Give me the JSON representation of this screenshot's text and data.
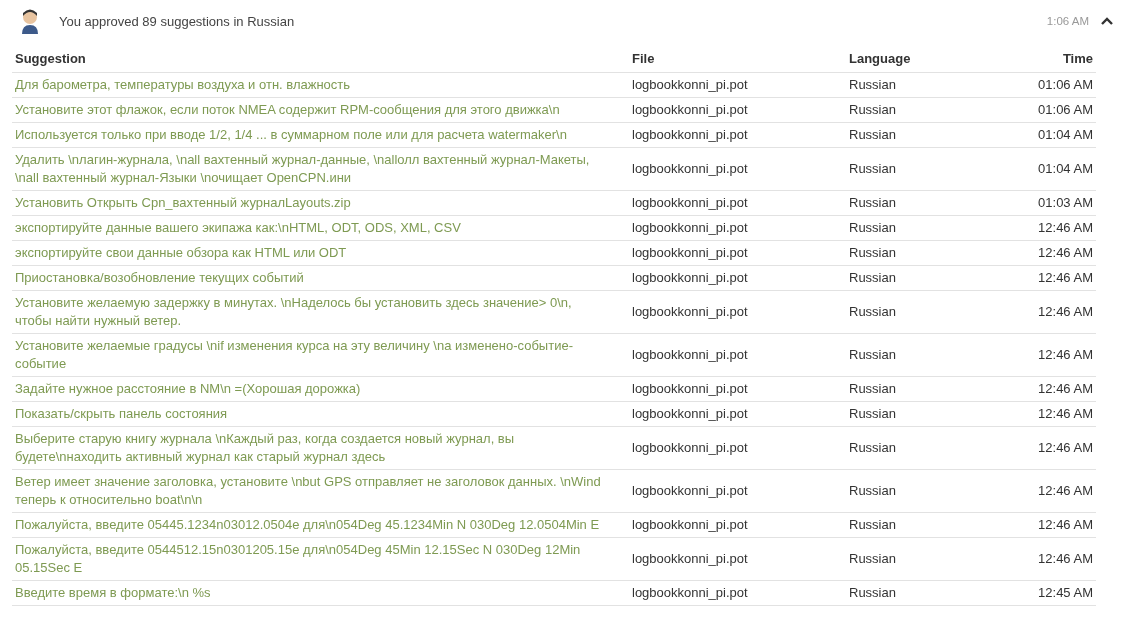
{
  "header": {
    "message": "You approved 89 suggestions in Russian",
    "time": "1:06 AM",
    "expanded": true
  },
  "table": {
    "columns": [
      "Suggestion",
      "File",
      "Language",
      "Time"
    ],
    "rows": [
      {
        "suggestion": "Для барометра, температуры воздуха и отн. влажность",
        "file": "logbookkonni_pi.pot",
        "language": "Russian",
        "time": "01:06 AM"
      },
      {
        "suggestion": "Установите этот флажок, если поток NMEA содержит RPM-сообщения для этого движка\\n",
        "file": "logbookkonni_pi.pot",
        "language": "Russian",
        "time": "01:06 AM"
      },
      {
        "suggestion": "Используется только при вводе 1/2, 1/4 ... в суммарном поле или для расчета watermaker\\n",
        "file": "logbookkonni_pi.pot",
        "language": "Russian",
        "time": "01:04 AM"
      },
      {
        "suggestion": "Удалить \\nлагин-журнала, \\nall вахтенный журнал-данные, \\nallолл вахтенный журнал-Макеты, \\nall вахтенный журнал-Языки \\nочищает OpenCPN.ини",
        "file": "logbookkonni_pi.pot",
        "language": "Russian",
        "time": "01:04 AM"
      },
      {
        "suggestion": "Установить Открыть Cpn_вахтенный журналLayouts.zip",
        "file": "logbookkonni_pi.pot",
        "language": "Russian",
        "time": "01:03 AM"
      },
      {
        "suggestion": "экспортируйте данные вашего экипажа как:\\nHTML, ODT, ODS, XML, CSV",
        "file": "logbookkonni_pi.pot",
        "language": "Russian",
        "time": "12:46 AM"
      },
      {
        "suggestion": "экспортируйте свои данные обзора как HTML или ODT",
        "file": "logbookkonni_pi.pot",
        "language": "Russian",
        "time": "12:46 AM"
      },
      {
        "suggestion": "Приостановка/возобновление текущих событий",
        "file": "logbookkonni_pi.pot",
        "language": "Russian",
        "time": "12:46 AM"
      },
      {
        "suggestion": "Установите желаемую задержку в минутах. \\nНаделось бы установить здесь значение> 0\\n, чтобы найти нужный ветер.",
        "file": "logbookkonni_pi.pot",
        "language": "Russian",
        "time": "12:46 AM"
      },
      {
        "suggestion": "Установите желаемые градусы \\nif изменения курса на эту величину \\na изменено-событие-событие",
        "file": "logbookkonni_pi.pot",
        "language": "Russian",
        "time": "12:46 AM"
      },
      {
        "suggestion": "Задайте нужное расстояние в NM\\n =(Хорошая дорожка)",
        "file": "logbookkonni_pi.pot",
        "language": "Russian",
        "time": "12:46 AM"
      },
      {
        "suggestion": "Показать/скрыть панель состояния",
        "file": "logbookkonni_pi.pot",
        "language": "Russian",
        "time": "12:46 AM"
      },
      {
        "suggestion": "Выберите старую книгу журнала \\nКаждый раз, когда создается новый журнал, вы будете\\nнаходить активный журнал как старый журнал здесь",
        "file": "logbookkonni_pi.pot",
        "language": "Russian",
        "time": "12:46 AM"
      },
      {
        "suggestion": "Ветер имеет значение заголовка, установите \\nbut GPS отправляет не заголовок данных. \\nWind теперь к относительно boat\\n\\n",
        "file": "logbookkonni_pi.pot",
        "language": "Russian",
        "time": "12:46 AM"
      },
      {
        "suggestion": "Пожалуйста, введите 05445.1234n03012.0504e для\\n054Deg 45.1234Min N 030Deg 12.0504Min E",
        "file": "logbookkonni_pi.pot",
        "language": "Russian",
        "time": "12:46 AM"
      },
      {
        "suggestion": "Пожалуйста, введите 0544512.15n0301205.15e для\\n054Deg 45Min 12.15Sec N 030Deg 12Min 05.15Sec E",
        "file": "logbookkonni_pi.pot",
        "language": "Russian",
        "time": "12:46 AM"
      },
      {
        "suggestion": "Введите время в формате:\\n %s",
        "file": "logbookkonni_pi.pot",
        "language": "Russian",
        "time": "12:45 AM"
      }
    ]
  }
}
